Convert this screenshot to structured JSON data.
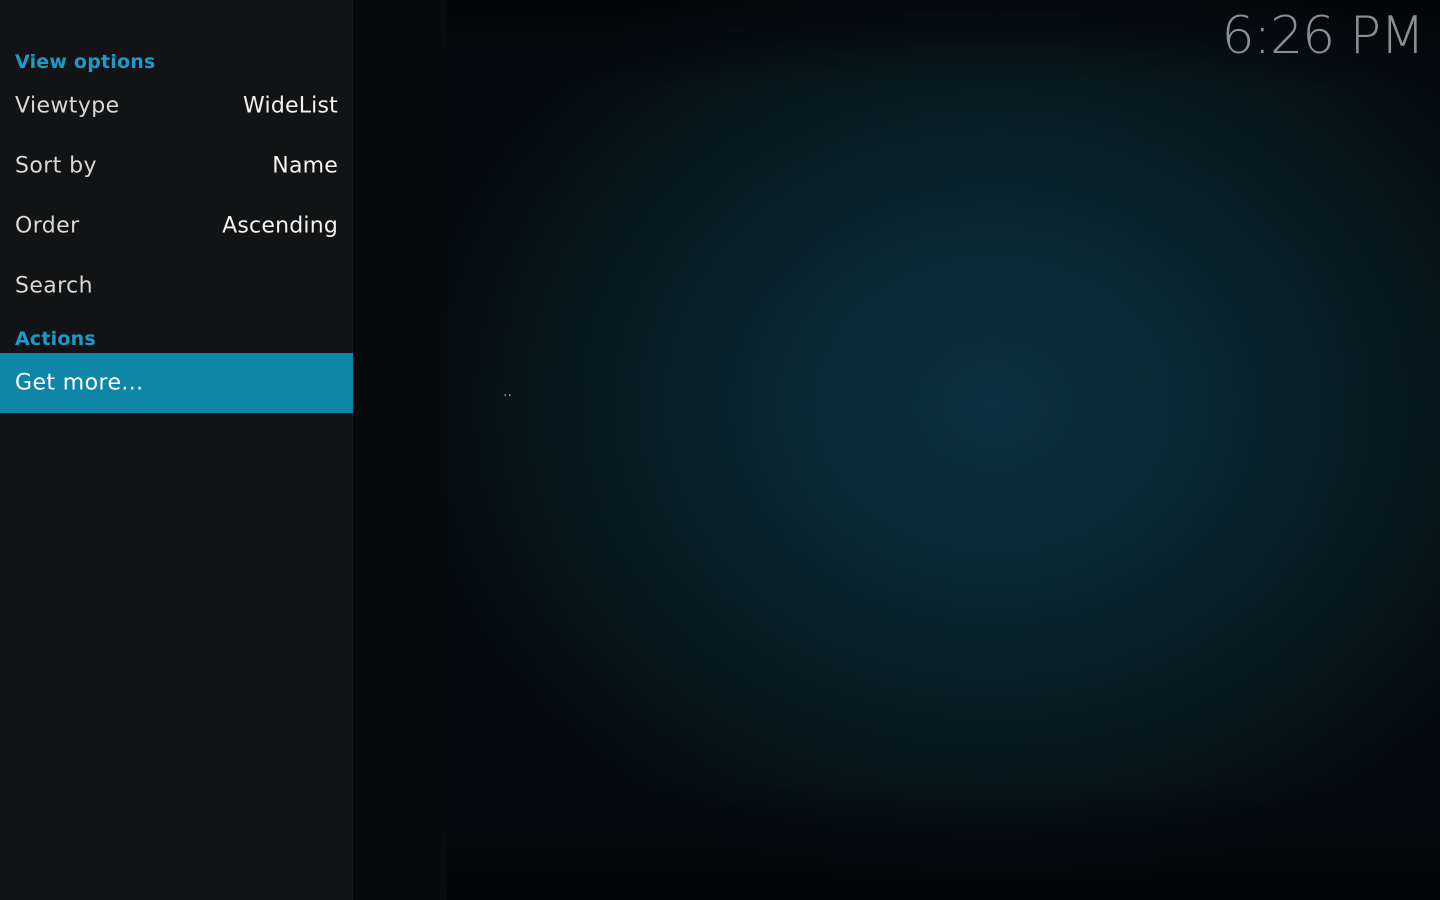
{
  "clock": "6:26 PM",
  "side_panel": {
    "view_options_header": "View options",
    "options": [
      {
        "label": "Viewtype",
        "value": "WideList"
      },
      {
        "label": "Sort by",
        "value": "Name"
      },
      {
        "label": "Order",
        "value": "Ascending"
      },
      {
        "label": "Search",
        "value": ""
      }
    ],
    "actions_header": "Actions",
    "actions": [
      {
        "label": "Get more..."
      }
    ]
  },
  "list": {
    "items": [
      {
        "label": ".."
      }
    ]
  },
  "colors": {
    "accent": "#1e9ac8",
    "selected_row": "#0f85a8",
    "panel_bg": "#121314"
  }
}
